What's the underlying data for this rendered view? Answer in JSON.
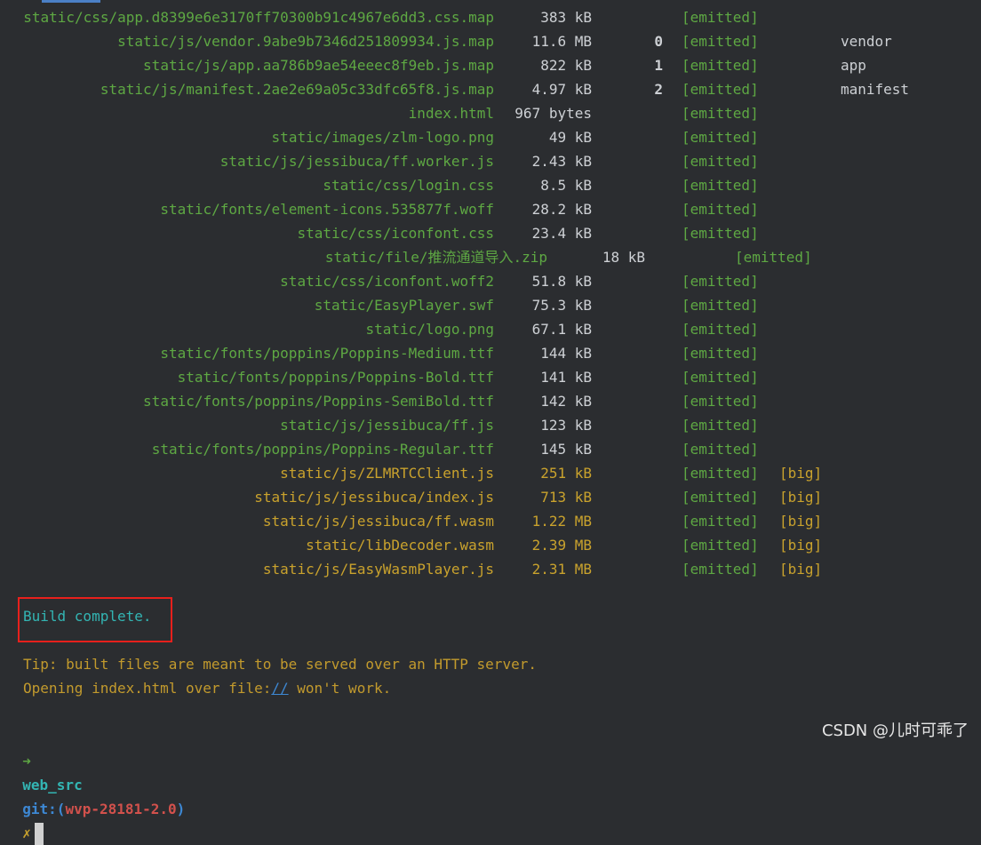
{
  "assets": [
    {
      "file": "static/css/app.d8399e6e3170ff70300b91c4967e6dd3.css.map",
      "size": "383 kB",
      "chunk": "",
      "status": "[emitted]",
      "big": "",
      "name": ""
    },
    {
      "file": "static/js/vendor.9abe9b7346d251809934.js.map",
      "size": "11.6 MB",
      "chunk": "0",
      "status": "[emitted]",
      "big": "",
      "name": "vendor"
    },
    {
      "file": "static/js/app.aa786b9ae54eeec8f9eb.js.map",
      "size": "822 kB",
      "chunk": "1",
      "status": "[emitted]",
      "big": "",
      "name": "app"
    },
    {
      "file": "static/js/manifest.2ae2e69a05c33dfc65f8.js.map",
      "size": "4.97 kB",
      "chunk": "2",
      "status": "[emitted]",
      "big": "",
      "name": "manifest"
    },
    {
      "file": "index.html",
      "size": "967 bytes",
      "chunk": "",
      "status": "[emitted]",
      "big": "",
      "name": ""
    },
    {
      "file": "static/images/zlm-logo.png",
      "size": "49 kB",
      "chunk": "",
      "status": "[emitted]",
      "big": "",
      "name": ""
    },
    {
      "file": "static/js/jessibuca/ff.worker.js",
      "size": "2.43 kB",
      "chunk": "",
      "status": "[emitted]",
      "big": "",
      "name": ""
    },
    {
      "file": "static/css/login.css",
      "size": "8.5 kB",
      "chunk": "",
      "status": "[emitted]",
      "big": "",
      "name": ""
    },
    {
      "file": "static/fonts/element-icons.535877f.woff",
      "size": "28.2 kB",
      "chunk": "",
      "status": "[emitted]",
      "big": "",
      "name": ""
    },
    {
      "file": "static/css/iconfont.css",
      "size": "23.4 kB",
      "chunk": "",
      "status": "[emitted]",
      "big": "",
      "name": ""
    },
    {
      "file": "static/file/推流通道导入.zip",
      "size": "18 kB",
      "chunk": "",
      "status": "[emitted]",
      "big": "",
      "name": ""
    },
    {
      "file": "static/css/iconfont.woff2",
      "size": "51.8 kB",
      "chunk": "",
      "status": "[emitted]",
      "big": "",
      "name": ""
    },
    {
      "file": "static/EasyPlayer.swf",
      "size": "75.3 kB",
      "chunk": "",
      "status": "[emitted]",
      "big": "",
      "name": ""
    },
    {
      "file": "static/logo.png",
      "size": "67.1 kB",
      "chunk": "",
      "status": "[emitted]",
      "big": "",
      "name": ""
    },
    {
      "file": "static/fonts/poppins/Poppins-Medium.ttf",
      "size": "144 kB",
      "chunk": "",
      "status": "[emitted]",
      "big": "",
      "name": ""
    },
    {
      "file": "static/fonts/poppins/Poppins-Bold.ttf",
      "size": "141 kB",
      "chunk": "",
      "status": "[emitted]",
      "big": "",
      "name": ""
    },
    {
      "file": "static/fonts/poppins/Poppins-SemiBold.ttf",
      "size": "142 kB",
      "chunk": "",
      "status": "[emitted]",
      "big": "",
      "name": ""
    },
    {
      "file": "static/js/jessibuca/ff.js",
      "size": "123 kB",
      "chunk": "",
      "status": "[emitted]",
      "big": "",
      "name": ""
    },
    {
      "file": "static/fonts/poppins/Poppins-Regular.ttf",
      "size": "145 kB",
      "chunk": "",
      "status": "[emitted]",
      "big": "",
      "name": ""
    },
    {
      "file": "static/js/ZLMRTCClient.js",
      "size": "251 kB",
      "chunk": "",
      "status": "[emitted]",
      "big": "[big]",
      "name": ""
    },
    {
      "file": "static/js/jessibuca/index.js",
      "size": "713 kB",
      "chunk": "",
      "status": "[emitted]",
      "big": "[big]",
      "name": ""
    },
    {
      "file": "static/js/jessibuca/ff.wasm",
      "size": "1.22 MB",
      "chunk": "",
      "status": "[emitted]",
      "big": "[big]",
      "name": ""
    },
    {
      "file": "static/libDecoder.wasm",
      "size": "2.39 MB",
      "chunk": "",
      "status": "[emitted]",
      "big": "[big]",
      "name": ""
    },
    {
      "file": "static/js/EasyWasmPlayer.js",
      "size": "2.31 MB",
      "chunk": "",
      "status": "[emitted]",
      "big": "[big]",
      "name": ""
    }
  ],
  "build_message": "Build complete.",
  "tip_line1": "Tip: built files are meant to be served over an HTTP server.",
  "tip_line2_prefix": "Opening index.html over file:",
  "tip_line2_link": "//",
  "tip_line2_suffix": " won't work.",
  "prompt": {
    "arrow": "➜",
    "dir": "web_src",
    "git_label": "git:(",
    "branch": "wvp-28181-2.0",
    "git_close": ")",
    "dirty_mark": "✗"
  },
  "watermark": "CSDN @儿时可乖了",
  "colors": {
    "background": "#2b2d30",
    "normal_asset": "#5ea843",
    "big_asset": "#c9a22d",
    "highlight_box": "#e8201c"
  }
}
